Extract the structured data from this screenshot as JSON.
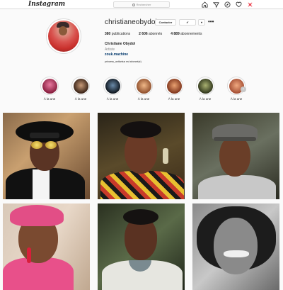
{
  "nav": {
    "logo": "Instagram",
    "search_placeholder": "Rechercher",
    "icons": [
      "home-icon",
      "direct-icon",
      "explore-icon",
      "heart-icon",
      "profile-icon"
    ]
  },
  "profile": {
    "username": "christianeobydol",
    "contact_label": "Contacter",
    "follow_label": "✔",
    "arrow_label": "▾",
    "more_label": "•••",
    "stats": [
      {
        "num": "380",
        "label": "publications"
      },
      {
        "num": "2 606",
        "label": "abonnés"
      },
      {
        "num": "4 889",
        "label": "abonnements"
      }
    ],
    "fullname": "Christiane Obydol",
    "category": "Artiste",
    "link": "zouk.machine",
    "followed_by": "princess_antlantus est abonné(e)"
  },
  "highlights": [
    {
      "label": "À la une",
      "color": "#b03a5a"
    },
    {
      "label": "À la une",
      "color": "#5a3a2a"
    },
    {
      "label": "À la une",
      "color": "#1c2a3a"
    },
    {
      "label": "À la une",
      "color": "#c77c48"
    },
    {
      "label": "À la une",
      "color": "#b45a3c"
    },
    {
      "label": "À la une",
      "color": "#3a4a2a"
    },
    {
      "label": "À la une",
      "color": "#c06a4a"
    }
  ],
  "colors": {
    "accent_link": "#00376b",
    "border": "#dbdbdb",
    "notification_heart": "#ed4956"
  }
}
